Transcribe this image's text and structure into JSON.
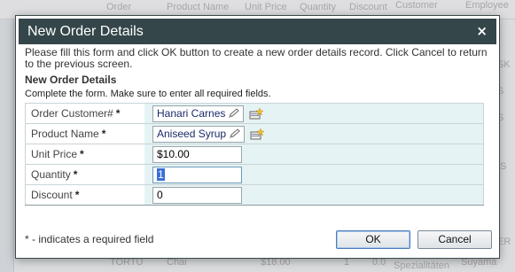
{
  "background": {
    "columns": [
      "Order",
      "Product Name",
      "Unit Price",
      "Quantity",
      "Discount",
      "Customer",
      "Employee"
    ],
    "right_fragments": [
      "SK",
      "S",
      "S",
      "IS",
      "I",
      "ER"
    ],
    "bottom_fragments": [
      "TORTU",
      "Chai",
      "$18.00",
      "1",
      "0.0",
      "Spezialitäten",
      "Suyama"
    ]
  },
  "dialog": {
    "title": "New Order Details",
    "close_glyph": "×",
    "instructions": "Please fill this form and click OK button to create a new order details record. Click Cancel to return to the previous screen.",
    "section_title": "New Order Details",
    "section_desc": "Complete the form. Make sure to enter all required fields.",
    "fields": {
      "customer": {
        "label": "Order Customer#",
        "required_mark": "*",
        "value": "Hanari Carnes"
      },
      "product": {
        "label": "Product Name",
        "required_mark": "*",
        "value": "Aniseed Syrup"
      },
      "unit_price": {
        "label": "Unit Price",
        "required_mark": "*",
        "value": "$10.00"
      },
      "quantity": {
        "label": "Quantity",
        "required_mark": "*",
        "value": "1"
      },
      "discount": {
        "label": "Discount",
        "required_mark": "*",
        "value": "0"
      }
    },
    "required_note": "* - indicates a required field",
    "ok_label": "OK",
    "cancel_label": "Cancel"
  },
  "colors": {
    "titlebar": "#34464a",
    "value_cell": "#e6f3f4",
    "lookup_text": "#1a2a6a",
    "selection": "#3a6fd8"
  },
  "icons": [
    "close-icon",
    "pencil-icon",
    "new-item-icon"
  ]
}
